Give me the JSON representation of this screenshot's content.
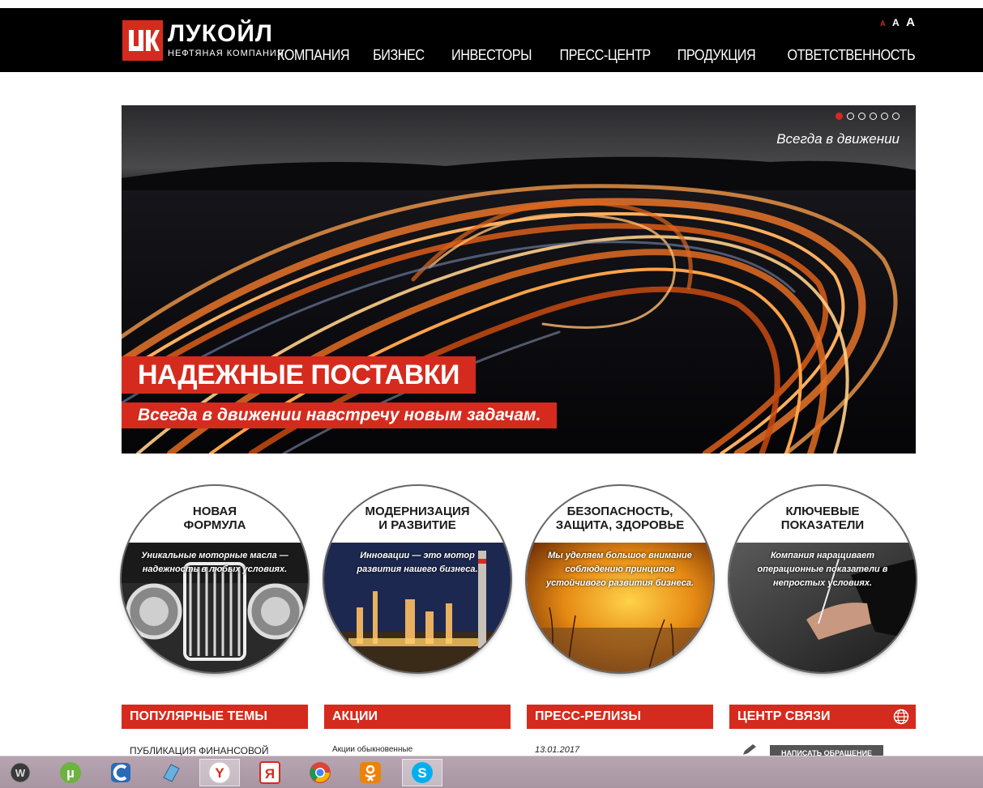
{
  "header": {
    "logo_name": "ЛУКОЙЛ",
    "logo_sub": "НЕФТЯНАЯ КОМПАНИЯ",
    "font_size_small": "A",
    "font_size_medium": "A",
    "font_size_large": "A",
    "nav": [
      "КОМПАНИЯ",
      "БИЗНЕС",
      "ИНВЕСТОРЫ",
      "ПРЕСС-ЦЕНТР",
      "ПРОДУКЦИЯ",
      "ОТВЕТСТВЕННОСТЬ"
    ]
  },
  "hero": {
    "tagline": "Всегда в движении",
    "title": "НАДЕЖНЫЕ ПОСТАВКИ",
    "subtitle": "Всегда в движении навстречу новым задачам.",
    "slide_count": 6,
    "active_slide": 1
  },
  "circles": [
    {
      "title_line1": "НОВАЯ",
      "title_line2": "ФОРМУЛА",
      "text": "Уникальные моторные масла — надежность в любых условиях."
    },
    {
      "title_line1": "МОДЕРНИЗАЦИЯ",
      "title_line2": "И РАЗВИТИЕ",
      "text": "Инновации — это мотор развития нашего бизнеса."
    },
    {
      "title_line1": "БЕЗОПАСНОСТЬ,",
      "title_line2": "ЗАЩИТА, ЗДОРОВЬЕ",
      "text": "Мы уделяем большое внимание соблюдению принципов устойчивого развития бизнеса."
    },
    {
      "title_line1": "КЛЮЧЕВЫЕ",
      "title_line2": "ПОКАЗАТЕЛИ",
      "text": "Компания наращивает операционные показатели в непростых условиях."
    }
  ],
  "sections": {
    "popular": "ПОПУЛЯРНЫЕ ТЕМЫ",
    "popular_item": "ПУБЛИКАЦИЯ ФИНАНСОВОЙ",
    "shares": "АКЦИИ",
    "shares_item": "Акции обыкновенные",
    "press": "ПРЕСС-РЕЛИЗЫ",
    "press_date": "13.01.2017",
    "contact": "ЦЕНТР СВЯЗИ",
    "contact_button": "НАПИСАТЬ ОБРАЩЕНИЕ"
  },
  "taskbar": {
    "apps": [
      "world-of-tanks-icon",
      "utorrent-icon",
      "ccleaner-icon",
      "notepad-icon",
      "yandex-browser-icon",
      "yandex-icon",
      "chrome-icon",
      "ok-icon",
      "skype-icon"
    ]
  },
  "colors": {
    "brand_red": "#d52b1e",
    "header_bg": "#000000"
  }
}
